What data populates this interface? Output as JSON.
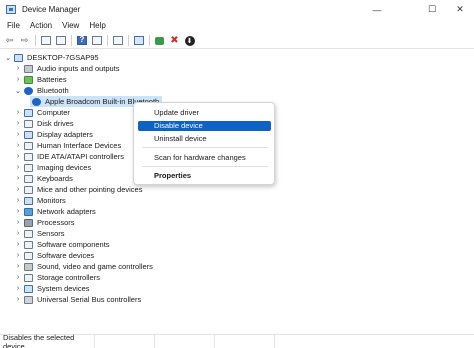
{
  "window": {
    "title": "Device Manager",
    "app_icon": "device-manager-icon",
    "minimize_glyph": "—",
    "maximize_glyph": "☐",
    "close_glyph": "✕"
  },
  "menu": [
    "File",
    "Action",
    "View",
    "Help"
  ],
  "toolbar": {
    "icons": [
      "back-icon",
      "forward-icon",
      "show-hide-console-tree-icon",
      "properties-icon",
      "help-icon",
      "action-pane-icon",
      "print-icon",
      "scan-hardware-icon",
      "enable-device-icon",
      "uninstall-device-icon",
      "update-driver-icon"
    ],
    "back_glyph": "⇦",
    "forward_glyph": "⇨",
    "x_glyph": "✖",
    "down_glyph": "⬇"
  },
  "tree": {
    "root": "DESKTOP-7GSAP95",
    "expanded_glyph": "⌄",
    "collapsed_glyph": "›",
    "categories_before": [
      "Audio inputs and outputs",
      "Batteries"
    ],
    "bluetooth": {
      "label": "Bluetooth",
      "child": "Apple Broadcom Built-in Bluetooth"
    },
    "categories_after": [
      "Computer",
      "Disk drives",
      "Display adapters",
      "Human Interface Devices",
      "IDE ATA/ATAPI controllers",
      "Imaging devices",
      "Keyboards",
      "Mice and other pointing devices",
      "Monitors",
      "Network adapters",
      "Processors",
      "Sensors",
      "Software components",
      "Software devices",
      "Sound, video and game controllers",
      "Storage controllers",
      "System devices",
      "Universal Serial Bus controllers"
    ]
  },
  "context_menu": {
    "items": [
      "Update driver",
      "Disable device",
      "Uninstall device",
      "Scan for hardware changes",
      "Properties"
    ],
    "highlighted": "Disable device",
    "highlight_color": "#0e62c6"
  },
  "status": {
    "text": "Disables the selected device."
  },
  "colors": {
    "selection": "#cce4f7",
    "bluetooth": "#1e64c8"
  }
}
